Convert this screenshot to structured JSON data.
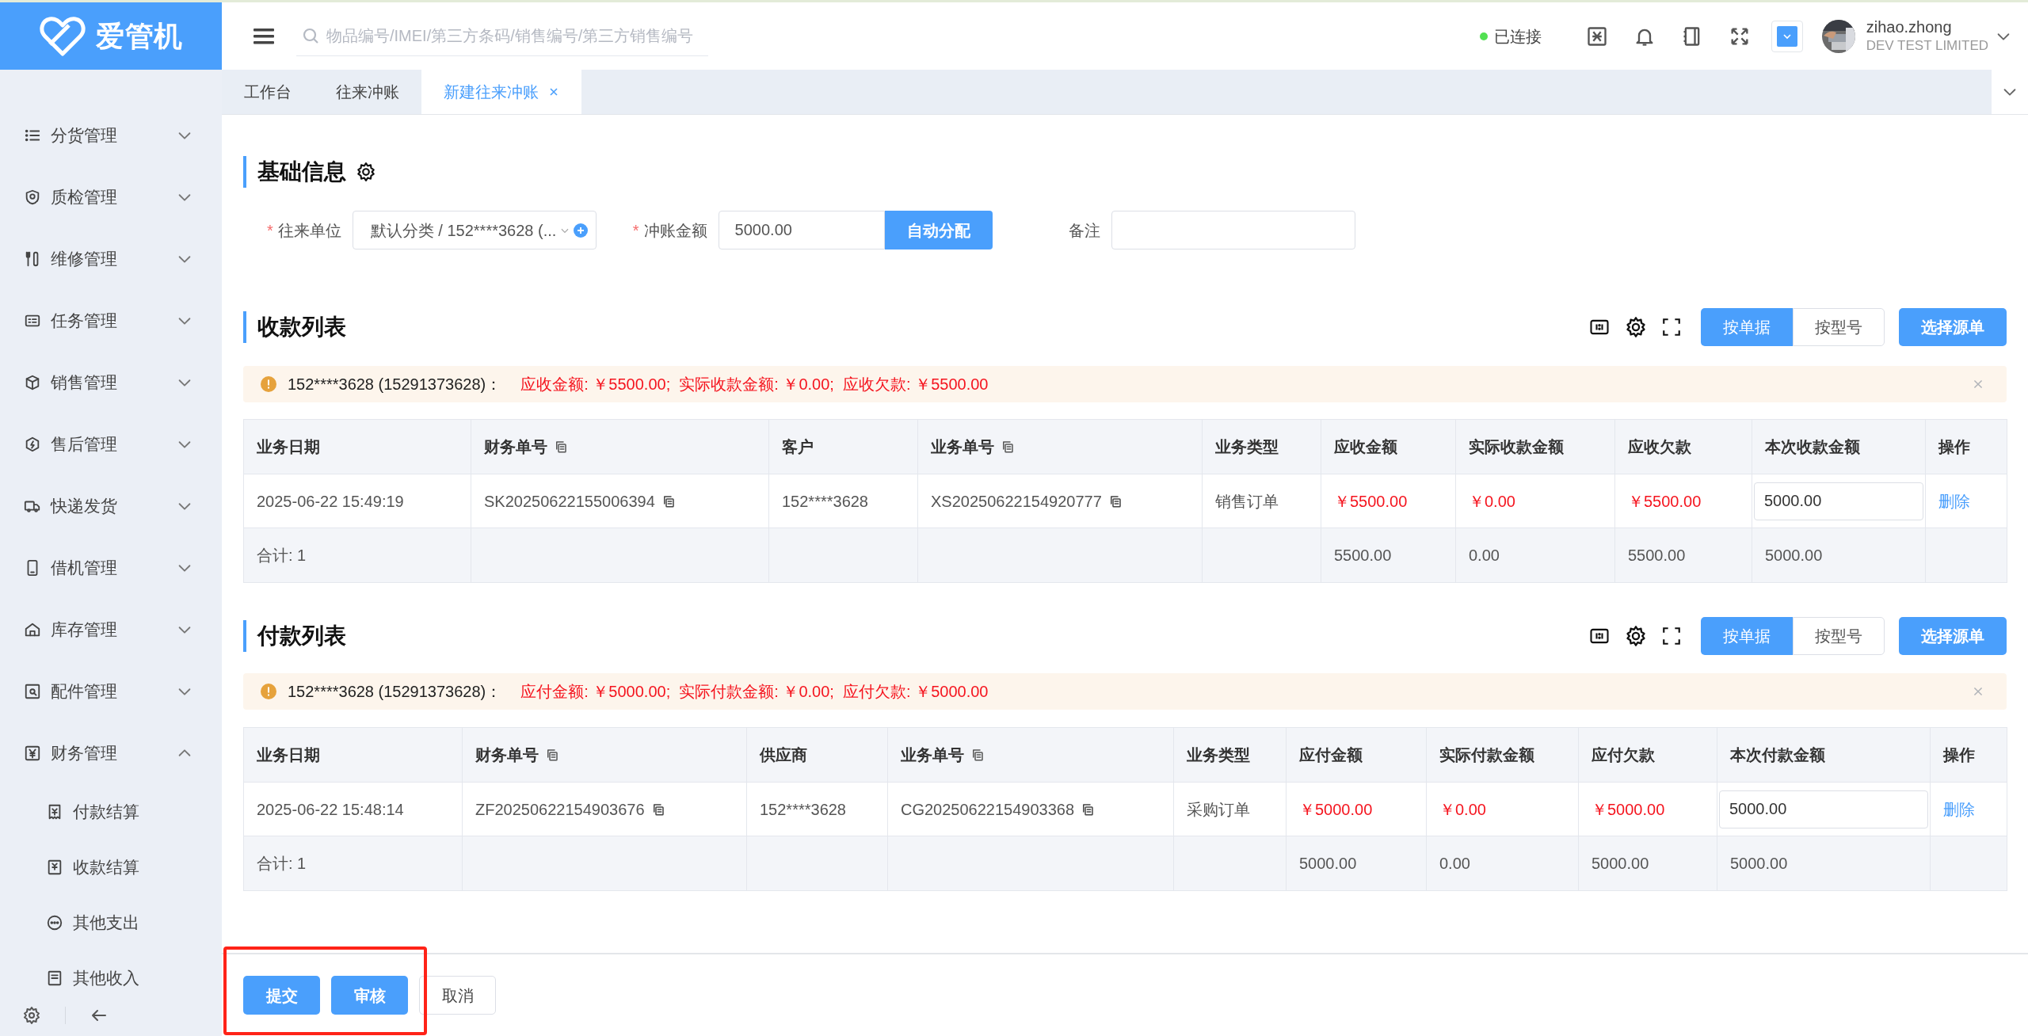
{
  "brand": "爱管机",
  "search": {
    "placeholder": "物品编号/IMEI/第三方条码/销售编号/第三方销售编号"
  },
  "header": {
    "status": "已连接",
    "connected": true,
    "user": "zihao.zhong",
    "company": "DEV TEST LIMITED"
  },
  "sidebar": {
    "items": [
      {
        "label": "分货管理",
        "expanded": false
      },
      {
        "label": "质检管理",
        "expanded": false
      },
      {
        "label": "维修管理",
        "expanded": false
      },
      {
        "label": "任务管理",
        "expanded": false
      },
      {
        "label": "销售管理",
        "expanded": false
      },
      {
        "label": "售后管理",
        "expanded": false
      },
      {
        "label": "快递发货",
        "expanded": false
      },
      {
        "label": "借机管理",
        "expanded": false
      },
      {
        "label": "库存管理",
        "expanded": false
      },
      {
        "label": "配件管理",
        "expanded": false
      },
      {
        "label": "财务管理",
        "expanded": true,
        "children": [
          {
            "label": "付款结算"
          },
          {
            "label": "收款结算"
          },
          {
            "label": "其他支出"
          },
          {
            "label": "其他收入"
          }
        ]
      }
    ]
  },
  "tabs": [
    {
      "label": "工作台",
      "selected": false,
      "closable": false
    },
    {
      "label": "往来冲账",
      "selected": false,
      "closable": false
    },
    {
      "label": "新建往来冲账",
      "selected": true,
      "closable": true
    }
  ],
  "basic_info": {
    "title": "基础信息",
    "fields": [
      {
        "kind": "select",
        "label": "往来单位",
        "required_mark": "*",
        "value": "默认分类 / 152****3628 (..."
      },
      {
        "kind": "amount",
        "label": "冲账金额",
        "required_mark": "*",
        "value": "5000.00",
        "button": "自动分配"
      },
      {
        "kind": "text",
        "label": "备注"
      }
    ]
  },
  "sections": [
    {
      "title": "收款列表",
      "view_toggle": [
        {
          "label": "按单据",
          "selected": true
        },
        {
          "label": "按型号",
          "selected": false
        }
      ],
      "select_button": "选择源单",
      "alert": {
        "party": "152****3628 (15291373628)：",
        "summary": "应收金额: ￥5500.00;  实际收款金额: ￥0.00;  应收欠款: ￥5500.00"
      },
      "columns": [
        {
          "label": "业务日期",
          "copy": false
        },
        {
          "label": "财务单号",
          "copy": true
        },
        {
          "label": "客户",
          "copy": false
        },
        {
          "label": "业务单号",
          "copy": true
        },
        {
          "label": "业务类型",
          "copy": false
        },
        {
          "label": "应收金额",
          "copy": false
        },
        {
          "label": "实际收款金额",
          "copy": false
        },
        {
          "label": "应收欠款",
          "copy": false
        },
        {
          "label": "本次收款金额",
          "copy": false
        },
        {
          "label": "操作",
          "copy": false
        }
      ],
      "rows": [
        [
          {
            "kind": "text",
            "text": "2025-06-22 15:49:19"
          },
          {
            "kind": "copy",
            "text": "SK20250622155006394"
          },
          {
            "kind": "text",
            "text": "152****3628"
          },
          {
            "kind": "copy",
            "text": "XS20250622154920777"
          },
          {
            "kind": "text",
            "text": "销售订单"
          },
          {
            "kind": "amount",
            "text": "￥5500.00"
          },
          {
            "kind": "amount",
            "text": "￥0.00"
          },
          {
            "kind": "amount",
            "text": "￥5500.00"
          },
          {
            "kind": "input",
            "text": "5000.00"
          },
          {
            "kind": "link",
            "text": "删除"
          }
        ]
      ],
      "totals": [
        {
          "kind": "text",
          "text": "合计: 1"
        },
        {
          "kind": "empty"
        },
        {
          "kind": "empty"
        },
        {
          "kind": "empty"
        },
        {
          "kind": "empty"
        },
        {
          "kind": "text",
          "text": "5500.00"
        },
        {
          "kind": "text",
          "text": "0.00"
        },
        {
          "kind": "text",
          "text": "5500.00"
        },
        {
          "kind": "text",
          "text": "5000.00"
        },
        {
          "kind": "empty"
        }
      ]
    },
    {
      "title": "付款列表",
      "view_toggle": [
        {
          "label": "按单据",
          "selected": true
        },
        {
          "label": "按型号",
          "selected": false
        }
      ],
      "select_button": "选择源单",
      "alert": {
        "party": "152****3628 (15291373628)：",
        "summary": "应付金额: ￥5000.00;  实际付款金额: ￥0.00;  应付欠款: ￥5000.00"
      },
      "columns": [
        {
          "label": "业务日期",
          "copy": false
        },
        {
          "label": "财务单号",
          "copy": true
        },
        {
          "label": "供应商",
          "copy": false
        },
        {
          "label": "业务单号",
          "copy": true
        },
        {
          "label": "业务类型",
          "copy": false
        },
        {
          "label": "应付金额",
          "copy": false
        },
        {
          "label": "实际付款金额",
          "copy": false
        },
        {
          "label": "应付欠款",
          "copy": false
        },
        {
          "label": "本次付款金额",
          "copy": false
        },
        {
          "label": "操作",
          "copy": false
        }
      ],
      "rows": [
        [
          {
            "kind": "text",
            "text": "2025-06-22 15:48:14"
          },
          {
            "kind": "copy",
            "text": "ZF20250622154903676"
          },
          {
            "kind": "text",
            "text": "152****3628"
          },
          {
            "kind": "copy",
            "text": "CG20250622154903368"
          },
          {
            "kind": "text",
            "text": "采购订单"
          },
          {
            "kind": "amount",
            "text": "￥5000.00"
          },
          {
            "kind": "amount",
            "text": "￥0.00"
          },
          {
            "kind": "amount",
            "text": "￥5000.00"
          },
          {
            "kind": "input",
            "text": "5000.00"
          },
          {
            "kind": "link",
            "text": "删除"
          }
        ]
      ],
      "totals": [
        {
          "kind": "text",
          "text": "合计: 1"
        },
        {
          "kind": "empty"
        },
        {
          "kind": "empty"
        },
        {
          "kind": "empty"
        },
        {
          "kind": "empty"
        },
        {
          "kind": "text",
          "text": "5000.00"
        },
        {
          "kind": "text",
          "text": "0.00"
        },
        {
          "kind": "text",
          "text": "5000.00"
        },
        {
          "kind": "text",
          "text": "5000.00"
        },
        {
          "kind": "empty"
        }
      ]
    }
  ],
  "footer": {
    "highlighted": true,
    "buttons": [
      {
        "kind": "primary",
        "label": "提交"
      },
      {
        "kind": "primary",
        "label": "审核"
      },
      {
        "kind": "default",
        "label": "取消"
      }
    ]
  }
}
